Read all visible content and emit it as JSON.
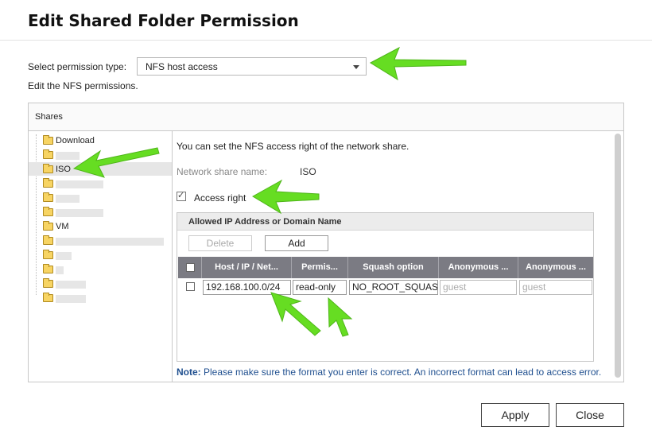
{
  "dialog": {
    "title": "Edit Shared Folder Permission"
  },
  "permission": {
    "label": "Select permission type:",
    "selected": "NFS host access",
    "description": "Edit the NFS permissions."
  },
  "shares": {
    "header": "Shares",
    "tree": [
      {
        "label": "Download",
        "redacted": false
      },
      {
        "label": "",
        "redacted": true
      },
      {
        "label": "ISO",
        "redacted": false,
        "selected": true
      },
      {
        "label": "",
        "redacted": true
      },
      {
        "label": "",
        "redacted": true
      },
      {
        "label": "",
        "redacted": true
      },
      {
        "label": "VM",
        "redacted": false
      },
      {
        "label": "",
        "redacted": true
      },
      {
        "label": "",
        "redacted": true
      },
      {
        "label": "",
        "redacted": true
      },
      {
        "label": "",
        "redacted": true
      },
      {
        "label": "",
        "redacted": true
      }
    ]
  },
  "content": {
    "info": "You can set the NFS access right of the network share.",
    "network_share_label": "Network share name:",
    "network_share_value": "ISO",
    "access_right_label": "Access right",
    "access_right_checked": true,
    "ip_box": {
      "title": "Allowed IP Address or Domain Name",
      "delete_label": "Delete",
      "add_label": "Add",
      "columns": [
        "Host / IP / Net...",
        "Permis...",
        "Squash option",
        "Anonymous ...",
        "Anonymous ..."
      ],
      "rows": [
        {
          "host": "192.168.100.0/24",
          "permission": "read-only",
          "squash": "NO_ROOT_SQUASH",
          "anon_uid": "guest",
          "anon_gid": "guest"
        }
      ]
    },
    "note_prefix": "Note:",
    "note_text": " Please make sure the format you enter is correct. An incorrect format can lead to access error."
  },
  "buttons": {
    "apply": "Apply",
    "close": "Close"
  },
  "colors": {
    "annotation_arrow": "#66dd22",
    "grid_header": "#7b7b83",
    "note_text": "#1f4f8f"
  }
}
